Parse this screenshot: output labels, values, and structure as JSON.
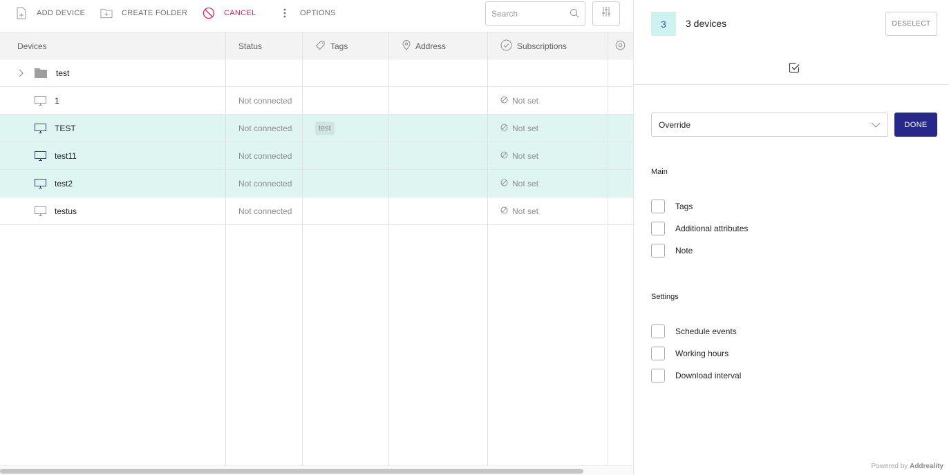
{
  "toolbar": {
    "add_device": "ADD DEVICE",
    "create_folder": "CREATE FOLDER",
    "cancel": "CANCEL",
    "options": "OPTIONS",
    "search_placeholder": "Search"
  },
  "table": {
    "columns": {
      "devices": "Devices",
      "status": "Status",
      "tags": "Tags",
      "address": "Address",
      "subscriptions": "Subscriptions"
    },
    "rows": [
      {
        "name": "test",
        "kind": "folder",
        "status": "",
        "tag": "",
        "subscription": "",
        "selected": false
      },
      {
        "name": "1",
        "kind": "device",
        "status": "Not connected",
        "tag": "",
        "subscription": "Not set",
        "selected": false
      },
      {
        "name": "TEST",
        "kind": "device",
        "status": "Not connected",
        "tag": "test",
        "subscription": "Not set",
        "selected": true
      },
      {
        "name": "test11",
        "kind": "device",
        "status": "Not connected",
        "tag": "",
        "subscription": "Not set",
        "selected": true
      },
      {
        "name": "test2",
        "kind": "device",
        "status": "Not connected",
        "tag": "",
        "subscription": "Not set",
        "selected": true
      },
      {
        "name": "testus",
        "kind": "device",
        "status": "Not connected",
        "tag": "",
        "subscription": "Not set",
        "selected": false
      }
    ]
  },
  "panel": {
    "count": "3",
    "count_label": "3 devices",
    "deselect": "DESELECT",
    "mode": "Override",
    "done": "DONE",
    "main_title": "Main",
    "main_options": [
      "Tags",
      "Additional attributes",
      "Note"
    ],
    "settings_title": "Settings",
    "settings_options": [
      "Schedule events",
      "Working hours",
      "Download interval"
    ],
    "powered_prefix": "Powered by",
    "powered_brand": "Addreality"
  },
  "colors": {
    "accent": "#27288a",
    "selected_row": "#dff5f2",
    "cancel": "#e0245e",
    "badge": "#cdf2ef"
  }
}
